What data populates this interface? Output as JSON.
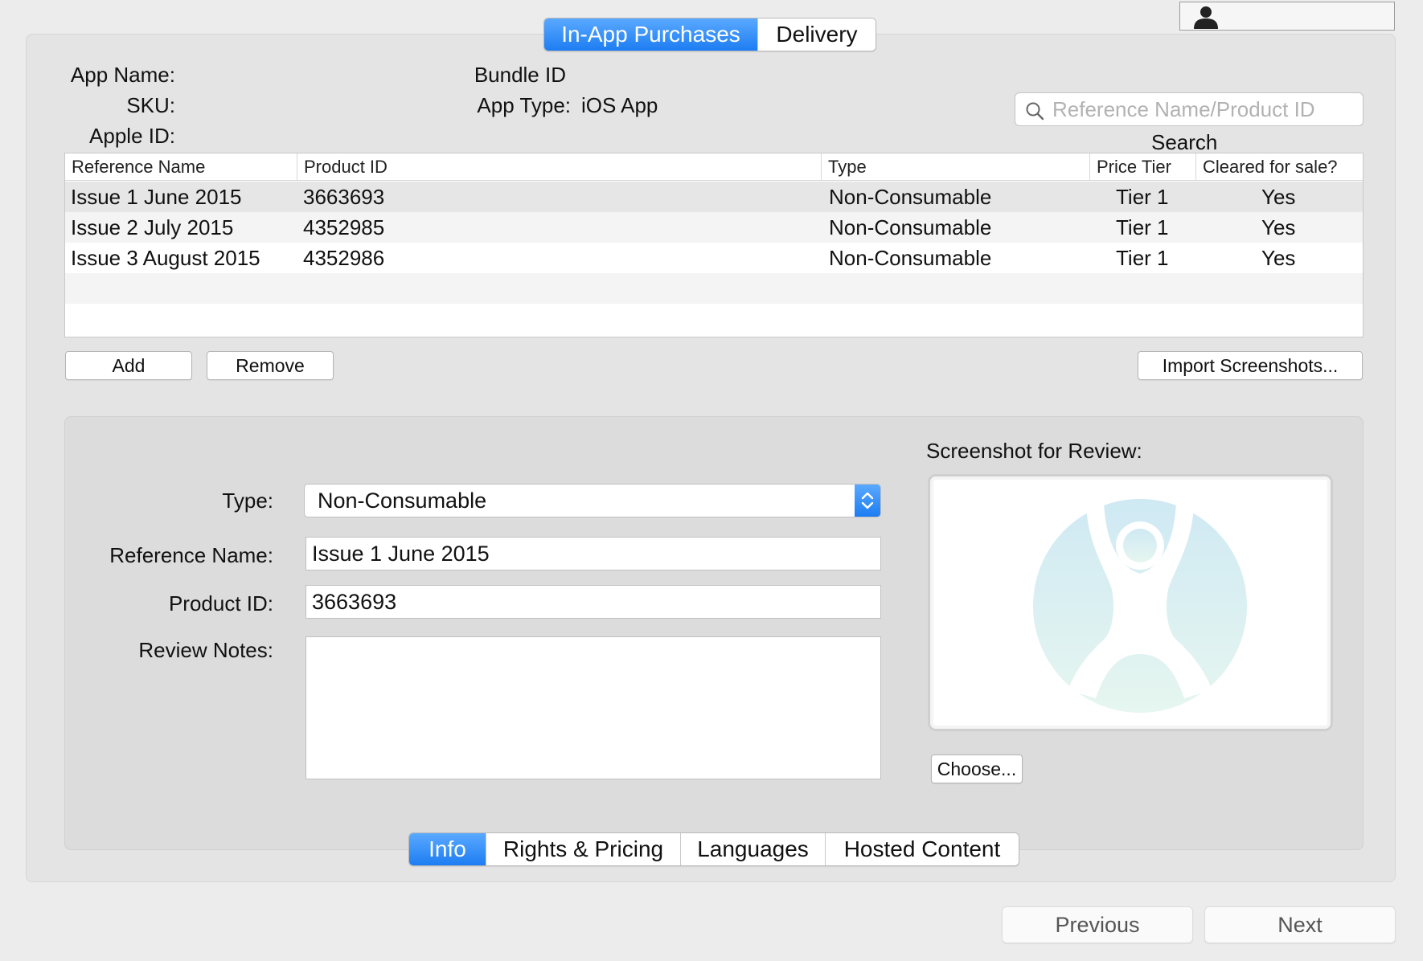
{
  "top_tabs": [
    {
      "label": "In-App Purchases",
      "active": true
    },
    {
      "label": "Delivery",
      "active": false
    }
  ],
  "app_info": {
    "app_name_label": "App Name:",
    "sku_label": "SKU:",
    "apple_id_label": "Apple ID:",
    "bundle_id_label": "Bundle ID",
    "app_type_label": "App Type:",
    "app_type_value": "iOS App"
  },
  "search": {
    "placeholder": "Reference Name/Product ID",
    "label": "Search"
  },
  "table": {
    "columns": [
      "Reference Name",
      "Product ID",
      "Type",
      "Price Tier",
      "Cleared for sale?"
    ],
    "rows": [
      {
        "reference_name": "Issue 1 June 2015",
        "product_id": "3663693",
        "type": "Non-Consumable",
        "price_tier": "Tier 1",
        "cleared": "Yes"
      },
      {
        "reference_name": "Issue 2 July 2015",
        "product_id": "4352985",
        "type": "Non-Consumable",
        "price_tier": "Tier 1",
        "cleared": "Yes"
      },
      {
        "reference_name": "Issue 3 August 2015",
        "product_id": "4352986",
        "type": "Non-Consumable",
        "price_tier": "Tier 1",
        "cleared": "Yes"
      }
    ]
  },
  "table_buttons": {
    "add": "Add",
    "remove": "Remove",
    "import_screenshots": "Import Screenshots..."
  },
  "detail": {
    "type_label": "Type:",
    "type_value": "Non-Consumable",
    "reference_name_label": "Reference Name:",
    "reference_name_value": "Issue 1 June 2015",
    "product_id_label": "Product ID:",
    "product_id_value": "3663693",
    "review_notes_label": "Review Notes:",
    "review_notes_value": "",
    "screenshot_label": "Screenshot for Review:",
    "choose_button": "Choose..."
  },
  "bottom_tabs": [
    {
      "label": "Info",
      "active": true
    },
    {
      "label": "Rights & Pricing",
      "active": false
    },
    {
      "label": "Languages",
      "active": false
    },
    {
      "label": "Hosted Content",
      "active": false
    }
  ],
  "navigation": {
    "previous": "Previous",
    "next": "Next"
  },
  "colors": {
    "accent": "#1d7df2",
    "row_selected": "#e6e6e6",
    "row_alt": "#f4f4f4"
  },
  "icons": {
    "account": "person-silhouette-icon",
    "search": "magnifier-icon",
    "select": "up-down-chevron-icon",
    "placeholder_image": "figure-in-circle-icon"
  }
}
